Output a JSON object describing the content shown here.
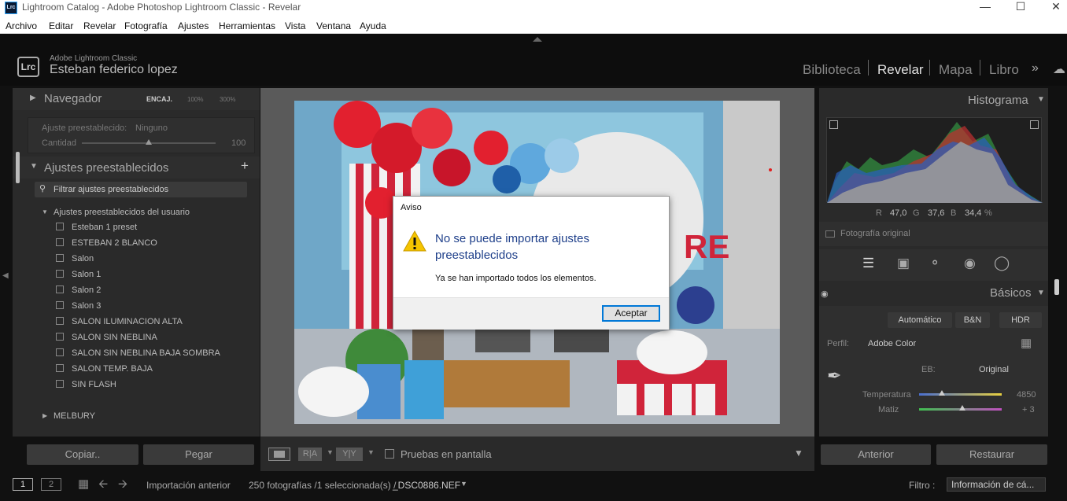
{
  "window": {
    "title": "Lightroom Catalog - Adobe Photoshop Lightroom Classic - Revelar",
    "icon": "Lrc"
  },
  "menu": [
    "Archivo",
    "Editar",
    "Revelar",
    "Fotografía",
    "Ajustes",
    "Herramientas",
    "Vista",
    "Ventana",
    "Ayuda"
  ],
  "identity": {
    "logo": "Lrc",
    "product": "Adobe Lightroom Classic",
    "user": "Esteban federico lopez"
  },
  "modules": [
    "Biblioteca",
    "Revelar",
    "Mapa",
    "Libro"
  ],
  "navigator": {
    "title": "Navegador",
    "zoom1": "ENCAJ.",
    "zoom2": "100%",
    "zoom3": "300%"
  },
  "preset_amount": {
    "label": "Ajuste preestablecido:",
    "value": "Ninguno",
    "amount_label": "Cantidad",
    "amount_value": "100"
  },
  "presets": {
    "title": "Ajustes preestablecidos",
    "filter_placeholder": "Filtrar ajustes preestablecidos",
    "group": "Ajustes preestablecidos del usuario",
    "items": [
      "Esteban 1 preset",
      "ESTEBAN 2 BLANCO",
      "Salon",
      "Salon 1",
      "Salon 2",
      "Salon 3",
      "SALON ILUMINACION ALTA",
      "SALON SIN NEBLINA",
      "SALON SIN NEBLINA BAJA SOMBRA",
      "SALON TEMP. BAJA",
      "SIN FLASH"
    ],
    "group2": "MELBURY"
  },
  "left_buttons": {
    "copy": "Copiar..",
    "paste": "Pegar"
  },
  "toolbar": {
    "proof": "Pruebas en pantalla"
  },
  "histogram": {
    "title": "Histograma",
    "r_label": "R",
    "r": "47,0",
    "g_label": "G",
    "g": "37,6",
    "b_label": "B",
    "b": "34,4",
    "pct": "%",
    "original": "Fotografía original"
  },
  "basic": {
    "title": "Básicos",
    "auto": "Automático",
    "bw": "B&N",
    "hdr": "HDR",
    "profile_label": "Perfil:",
    "profile_value": "Adobe Color",
    "wb_label": "EB:",
    "wb_value": "Original",
    "temp_label": "Temperatura",
    "temp_value": "4850",
    "temp_level": 0.28,
    "tint_label": "Matiz",
    "tint_value": "+ 3",
    "tint_level": 0.52
  },
  "right_buttons": {
    "prev": "Anterior",
    "reset": "Restaurar"
  },
  "dialog": {
    "header": "Aviso",
    "title": "No se puede importar ajustes preestablecidos",
    "message": "Ya se han importado todos los elementos.",
    "ok": "Aceptar"
  },
  "filmstrip": {
    "page1": "1",
    "page2": "2",
    "source": "Importación anterior",
    "count": "250 fotografías /1 seleccionada(s) /",
    "file": "_DSC0886.NEF",
    "filter_label": "Filtro :",
    "filter_value": "Información de cá..."
  }
}
